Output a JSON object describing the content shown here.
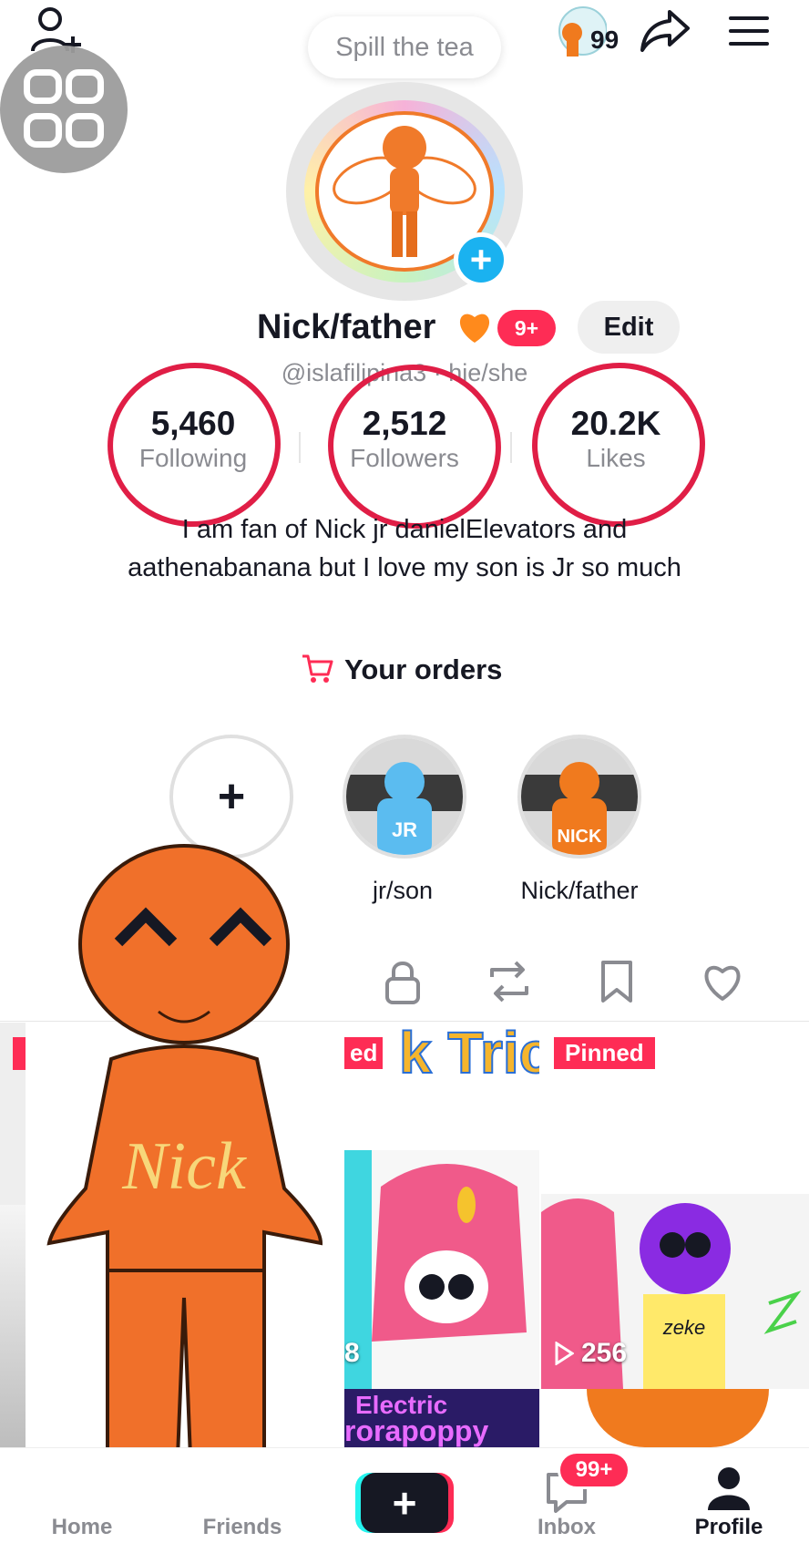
{
  "top_bar": {
    "story_prompt": "Spill the tea",
    "coin_count": "99"
  },
  "profile": {
    "name": "Nick/father",
    "notification_badge": "9+",
    "edit_label": "Edit",
    "handle_line": "@islafilipina3 · hie/she",
    "stats": [
      {
        "value": "5,460",
        "label": "Following"
      },
      {
        "value": "2,512",
        "label": "Followers"
      },
      {
        "value": "20.2K",
        "label": "Likes"
      }
    ],
    "bio": "I am fan of Nick jr danielElevators and aathenabanana but I love my son is Jr so much",
    "orders_label": "Your orders"
  },
  "highlights": [
    {
      "label": "jr/son",
      "tag": "JR",
      "color": "#5bbcf0"
    },
    {
      "label": "Nick/father",
      "tag": "NICK",
      "color": "#f07a1e"
    }
  ],
  "videos": {
    "pinned_label": "Pinned",
    "pinned_partial_label": "ed",
    "banner_text": "k Tric",
    "views": [
      "8",
      "256"
    ],
    "bottom_text_1": "Electric",
    "bottom_text_2": "rorapoppy",
    "sticker_text": "Nick",
    "zeke_label": "zeke"
  },
  "bottom_nav": {
    "home": "Home",
    "friends": "Friends",
    "inbox": "Inbox",
    "inbox_badge": "99+",
    "profile": "Profile"
  },
  "colors": {
    "accent": "#fe2c55",
    "cyan": "#25f4ee",
    "orange": "#f07a2a"
  }
}
